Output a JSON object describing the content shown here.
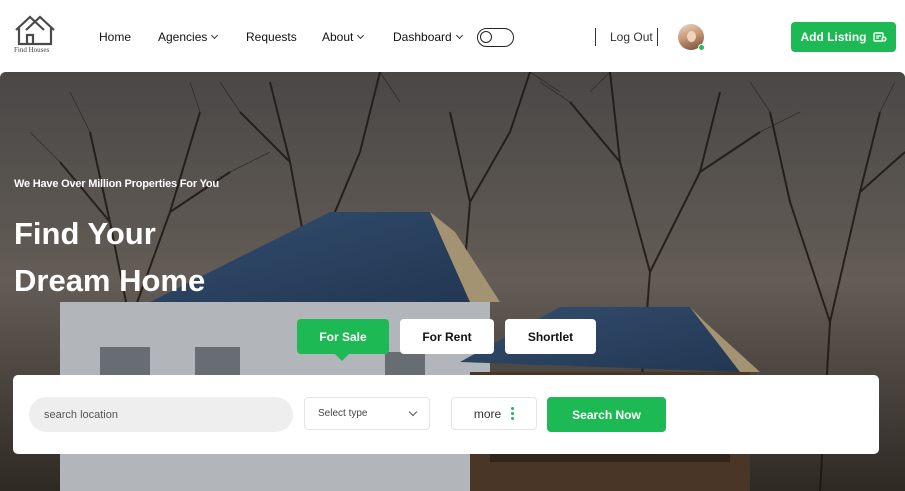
{
  "brand": {
    "name": "Find Houses",
    "accent": "#1db954"
  },
  "nav": {
    "items": [
      {
        "label": "Home",
        "has_dropdown": false
      },
      {
        "label": "Agencies",
        "has_dropdown": true
      },
      {
        "label": "Requests",
        "has_dropdown": false
      },
      {
        "label": "About",
        "has_dropdown": true
      },
      {
        "label": "Dashboard",
        "has_dropdown": true
      }
    ],
    "theme_toggle": {
      "icon": "toggle-icon",
      "on": false
    },
    "logout_label": "Log Out",
    "user": {
      "icon": "avatar",
      "online": true,
      "status_color": "#1fbf5a"
    },
    "add_listing": {
      "label": "Add Listing",
      "icon": "add-listing-icon"
    }
  },
  "hero": {
    "tagline": "We Have Over Million Properties For You",
    "headline_line1": "Find Your",
    "headline_line2": "Dream Home",
    "tabs": [
      {
        "label": "For Sale",
        "active": true
      },
      {
        "label": "For Rent",
        "active": false
      },
      {
        "label": "Shortlet",
        "active": false
      }
    ]
  },
  "search": {
    "location_placeholder": "search location",
    "location_value": "",
    "type_select": {
      "selected": "Select type",
      "icon": "chevron-down-icon"
    },
    "more_label": "more",
    "more_icon": "vertical-dots-icon",
    "submit_label": "Search Now"
  }
}
